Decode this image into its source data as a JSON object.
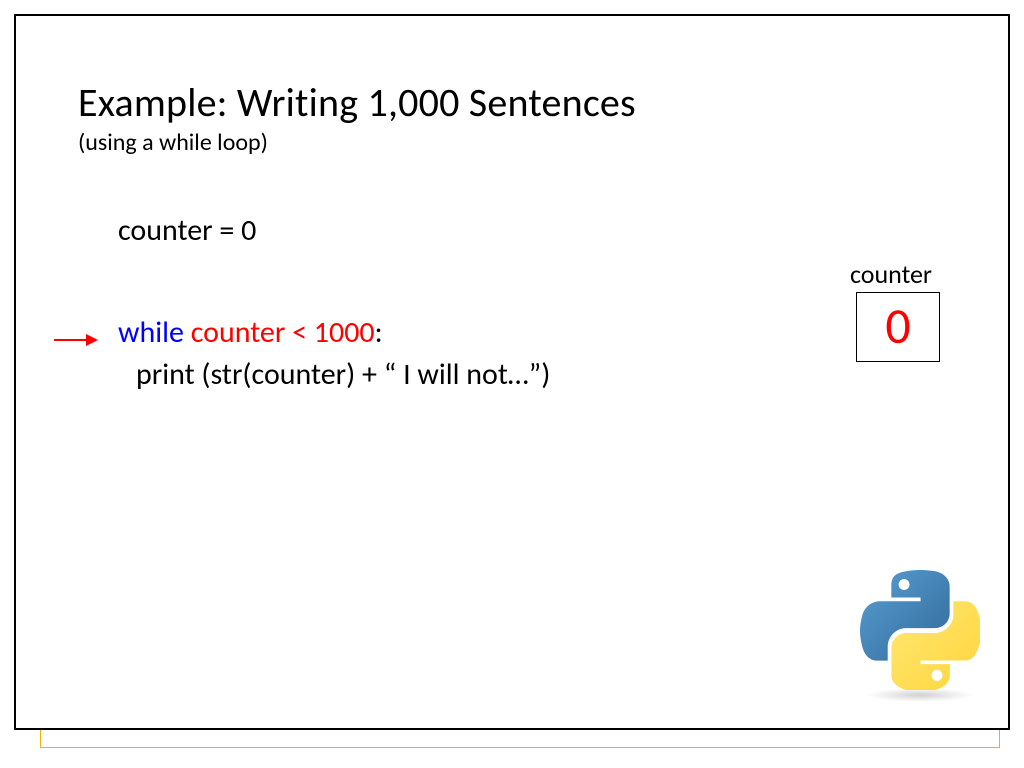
{
  "title": "Example: Writing 1,000 Sentences",
  "subtitle": "(using a while loop)",
  "code": {
    "line1": "counter = 0",
    "line2_keyword": "while",
    "line2_condition": " counter < 1000",
    "line2_colon": ":",
    "line3": "print (str(counter) + “ I will not…”)"
  },
  "counter": {
    "label": "counter",
    "value": "0"
  }
}
